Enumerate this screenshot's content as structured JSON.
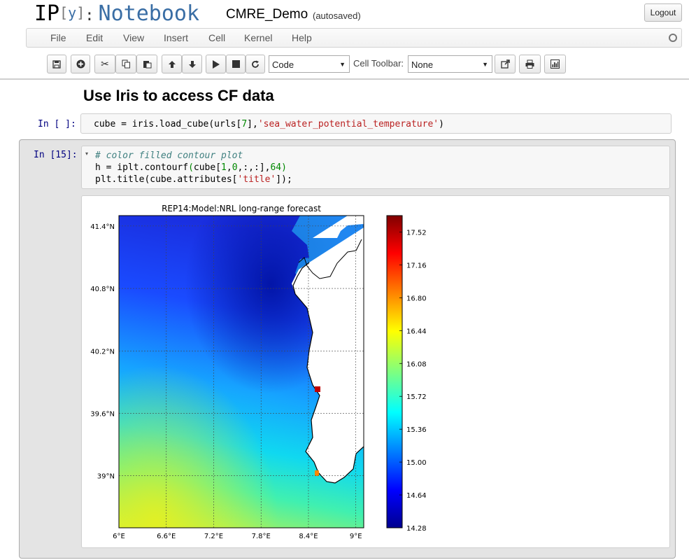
{
  "header": {
    "logo_ip": "IP",
    "logo_y": "y",
    "logo_nb": "Notebook",
    "notebook_name": "CMRE_Demo",
    "autosave": "(autosaved)",
    "logout": "Logout"
  },
  "menu": [
    "File",
    "Edit",
    "View",
    "Insert",
    "Cell",
    "Kernel",
    "Help"
  ],
  "toolbar": {
    "cell_type": "Code",
    "cell_toolbar_label": "Cell Toolbar:",
    "cell_toolbar_value": "None"
  },
  "heading": "Use Iris to access CF data",
  "cells": [
    {
      "prompt": "In [ ]:"
    },
    {
      "prompt": "In [15]:"
    }
  ],
  "chart_data": {
    "type": "heatmap",
    "title": "REP14:Model:NRL long-range forecast",
    "xlabel": "",
    "ylabel": "",
    "x_ticks": [
      "6°E",
      "6.6°E",
      "7.2°E",
      "7.8°E",
      "8.4°E",
      "9°E"
    ],
    "y_ticks": [
      "41.4°N",
      "40.8°N",
      "40.2°N",
      "39.6°N",
      "39°N"
    ],
    "xlim": [
      6.0,
      9.1
    ],
    "ylim": [
      38.5,
      41.5
    ],
    "grid": true,
    "colorbar_ticks": [
      "17.52",
      "17.16",
      "16.80",
      "16.44",
      "16.08",
      "15.72",
      "15.36",
      "15.00",
      "14.64",
      "14.28"
    ],
    "colorbar_range": [
      14.28,
      17.7
    ],
    "colormap": "jet"
  }
}
